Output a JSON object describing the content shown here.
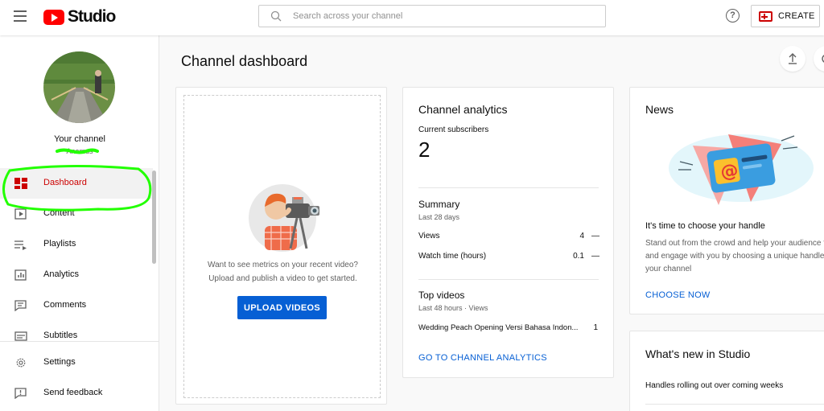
{
  "header": {
    "logo_text": "Studio",
    "search_placeholder": "Search across your channel",
    "help_label": "?",
    "create_label": "CREATE"
  },
  "sidebar": {
    "channel_title": "Your channel",
    "channel_name": "Anamus",
    "items": [
      {
        "label": "Dashboard",
        "icon": "dashboard-icon",
        "active": true
      },
      {
        "label": "Content",
        "icon": "content-icon"
      },
      {
        "label": "Playlists",
        "icon": "playlists-icon"
      },
      {
        "label": "Analytics",
        "icon": "analytics-icon"
      },
      {
        "label": "Comments",
        "icon": "comments-icon"
      },
      {
        "label": "Subtitles",
        "icon": "subtitles-icon"
      }
    ],
    "bottom_items": [
      {
        "label": "Settings",
        "icon": "gear-icon"
      },
      {
        "label": "Send feedback",
        "icon": "feedback-icon"
      }
    ]
  },
  "main": {
    "page_title": "Channel dashboard",
    "upload_card": {
      "text_line1": "Want to see metrics on your recent video?",
      "text_line2": "Upload and publish a video to get started.",
      "button_label": "UPLOAD VIDEOS"
    },
    "analytics_card": {
      "title": "Channel analytics",
      "subscribers_label": "Current subscribers",
      "subscribers_value": "2",
      "summary_title": "Summary",
      "summary_period": "Last 28 days",
      "rows": [
        {
          "label": "Views",
          "value": "4",
          "trend": "—"
        },
        {
          "label": "Watch time (hours)",
          "value": "0.1",
          "trend": "—"
        }
      ],
      "top_videos_title": "Top videos",
      "top_videos_period": "Last 48 hours · Views",
      "top_videos": [
        {
          "title": "Wedding Peach Opening Versi Bahasa Indon...",
          "views": "1"
        }
      ],
      "link_label": "GO TO CHANNEL ANALYTICS"
    },
    "news_card": {
      "title": "News",
      "headline": "It's time to choose your handle",
      "body": "Stand out from the crowd and help your audience find and engage with you by choosing a unique handle for your channel",
      "link_label": "CHOOSE NOW"
    },
    "whats_new_card": {
      "title": "What's new in Studio",
      "items": [
        "Handles rolling out over coming weeks"
      ]
    }
  },
  "colors": {
    "brand_red": "#ff0000",
    "active_red": "#cc0000",
    "link_blue": "#065fd4",
    "annotation_green": "#22ff00"
  }
}
